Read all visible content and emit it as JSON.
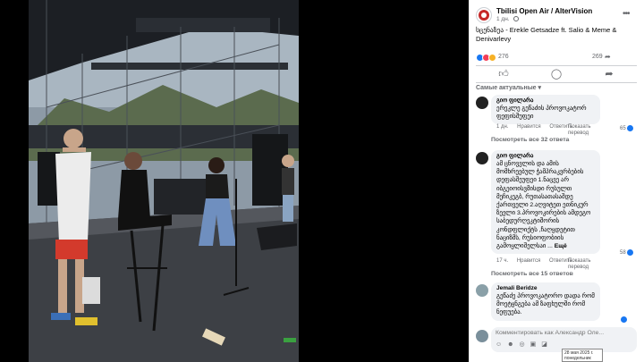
{
  "post": {
    "page_name": "Tbilisi Open Air / AlterVision",
    "time": "1 дн.",
    "caption": "სცენაზეა - Erekle Getsadze ft. Salio & Meme & Denivarlevy",
    "reactions_count": "276",
    "shares_count": "269"
  },
  "sort_label": "Самые актуальные",
  "comments": [
    {
      "author": "გიო ფილარა",
      "text": "ერეკლე გეწაძის პროვოკატორ ფეფისშუფეი",
      "time": "1 дн.",
      "like": "Нравится",
      "reply": "Ответить",
      "translate": "Показать перевод",
      "reactions": "65",
      "replies": "Посмотреть все 32 ответа"
    },
    {
      "author": "გიო ფილარა",
      "text": "ამ ცნოვვლის და ამის მომხრეებულ ჭამპრაკვრბების დეფასშეუფეი 1.ნაცვე არ იბგეიოისვმისდი რუსულთ მეჩიკეგბ, რუთასათასაშდე ქართველი 2.აღვიტეთ ეთნიკურ ზეელი 3.პროვოკირების ამდეგო საბედურღეკტიშორის კონდფლიქტს ,ჩაღყდეტით ნაციზმს, რუსიოფობიის გამოყლიშელსაი ...",
      "more": "Ещё",
      "time": "17 ч.",
      "like": "Нравится",
      "reply": "Ответить",
      "translate": "Показать перевод",
      "reactions": "58",
      "replies": "Посмотреть все 15 ответов"
    },
    {
      "author": "Jemali Beridze",
      "text": "გეწაძე პროვოკატორო დადა რომ მოეტყნგება ამ ზაფხულში რომ ნეფუება.",
      "time": "",
      "reactions": ""
    }
  ],
  "write_placeholder": "Комментировать как Александр Оле...",
  "tooltip_text": "28 мая 2025 г. понедельник",
  "icons": {
    "globe": "globe-icon",
    "more": "more-icon",
    "like": "like-icon",
    "comment": "comment-icon",
    "share": "share-icon"
  },
  "colors": {
    "accent": "#1877f2",
    "text": "#050505",
    "secondary": "#65676b",
    "bubble": "#f0f2f5"
  }
}
